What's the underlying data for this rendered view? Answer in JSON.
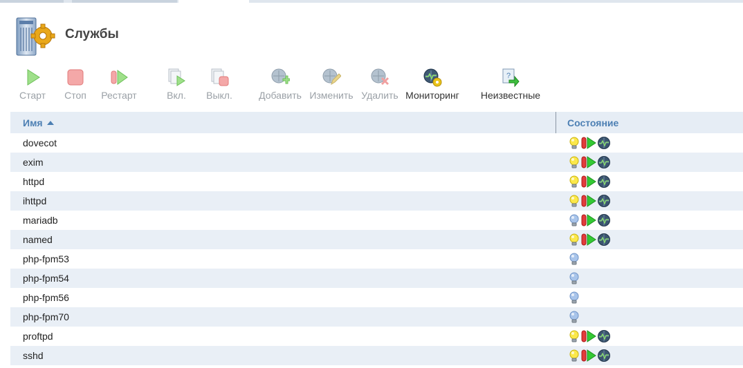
{
  "page": {
    "title": "Службы"
  },
  "toolbar": {
    "start": "Старт",
    "stop": "Стоп",
    "restart": "Рестарт",
    "enable": "Вкл.",
    "disable": "Выкл.",
    "add": "Добавить",
    "edit": "Изменить",
    "delete": "Удалить",
    "monitoring": "Мониторинг",
    "unknown": "Неизвестные"
  },
  "table": {
    "columns": {
      "name": "Имя",
      "state": "Состояние"
    },
    "sort": "ascending",
    "rows": [
      {
        "name": "dovecot",
        "state": "enabled-running-monitored"
      },
      {
        "name": "exim",
        "state": "enabled-running-monitored"
      },
      {
        "name": "httpd",
        "state": "enabled-running-monitored"
      },
      {
        "name": "ihttpd",
        "state": "enabled-running-monitored"
      },
      {
        "name": "mariadb",
        "state": "disabled-running-monitored"
      },
      {
        "name": "named",
        "state": "enabled-running-monitored"
      },
      {
        "name": "php-fpm53",
        "state": "disabled"
      },
      {
        "name": "php-fpm54",
        "state": "disabled"
      },
      {
        "name": "php-fpm56",
        "state": "disabled"
      },
      {
        "name": "php-fpm70",
        "state": "disabled"
      },
      {
        "name": "proftpd",
        "state": "enabled-running-monitored"
      },
      {
        "name": "sshd",
        "state": "enabled-running-monitored"
      }
    ]
  },
  "icons": {
    "bulb_on": "bulb-on-icon",
    "bulb_off": "bulb-off-icon",
    "running": "running-icon",
    "monitor": "monitor-icon"
  },
  "colors": {
    "accent": "#4c7fb3",
    "row_alt": "#e9eff6",
    "header_bg": "#e6edf5"
  }
}
